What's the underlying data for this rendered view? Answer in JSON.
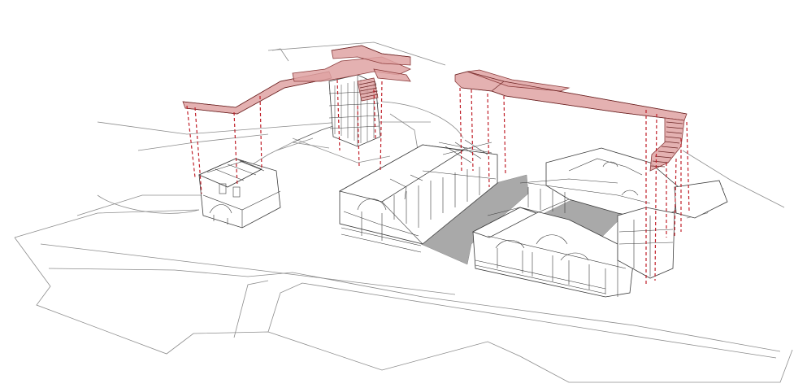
{
  "colors": {
    "walkway_fill": "#dfa3a3",
    "support_lines": "#c0202a",
    "courtyard_paving": "#a9a9a9"
  }
}
